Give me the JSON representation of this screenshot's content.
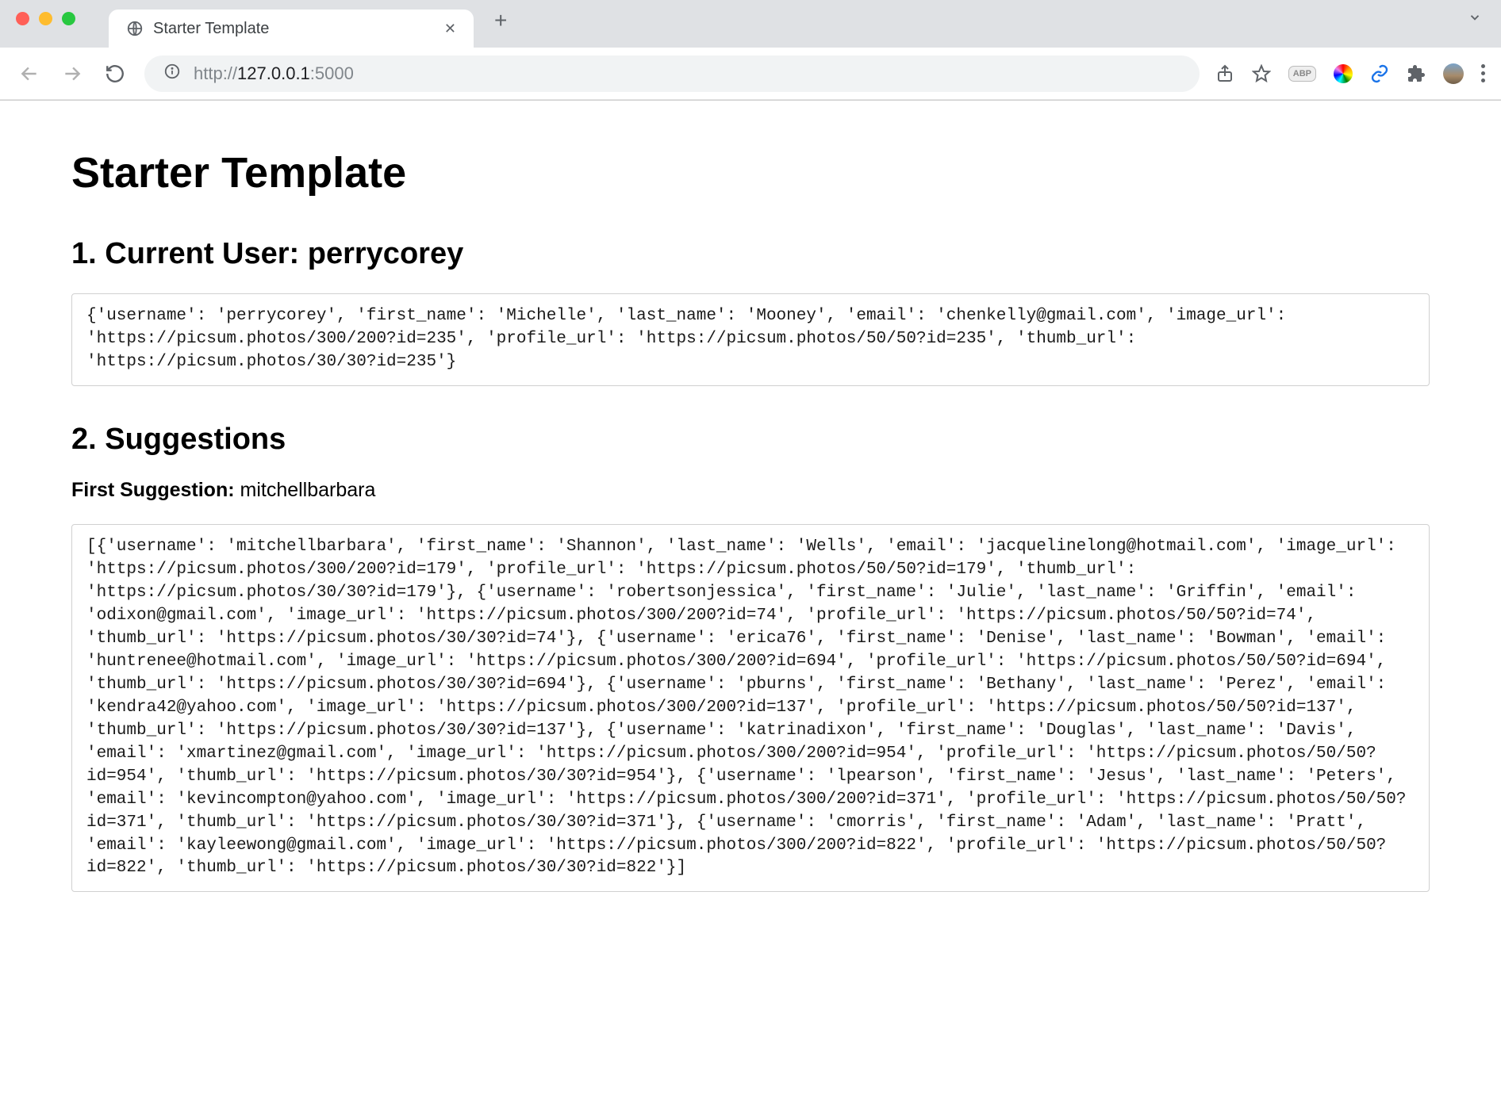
{
  "browser": {
    "tab_title": "Starter Template",
    "url_scheme": "http://",
    "url_host": "127.0.0.1",
    "url_port": ":5000"
  },
  "page": {
    "title": "Starter Template",
    "section1_prefix": "1. Current User: ",
    "current_username": "perrycorey",
    "current_user_dump": "{'username': 'perrycorey', 'first_name': 'Michelle', 'last_name': 'Mooney', 'email': 'chenkelly@gmail.com', 'image_url': 'https://picsum.photos/300/200?id=235', 'profile_url': 'https://picsum.photos/50/50?id=235', 'thumb_url': 'https://picsum.photos/30/30?id=235'}",
    "section2_heading": "2. Suggestions",
    "first_suggestion_label": "First Suggestion: ",
    "first_suggestion_username": "mitchellbarbara",
    "suggestions_dump": "[{'username': 'mitchellbarbara', 'first_name': 'Shannon', 'last_name': 'Wells', 'email': 'jacquelinelong@hotmail.com', 'image_url': 'https://picsum.photos/300/200?id=179', 'profile_url': 'https://picsum.photos/50/50?id=179', 'thumb_url': 'https://picsum.photos/30/30?id=179'}, {'username': 'robertsonjessica', 'first_name': 'Julie', 'last_name': 'Griffin', 'email': 'odixon@gmail.com', 'image_url': 'https://picsum.photos/300/200?id=74', 'profile_url': 'https://picsum.photos/50/50?id=74', 'thumb_url': 'https://picsum.photos/30/30?id=74'}, {'username': 'erica76', 'first_name': 'Denise', 'last_name': 'Bowman', 'email': 'huntrenee@hotmail.com', 'image_url': 'https://picsum.photos/300/200?id=694', 'profile_url': 'https://picsum.photos/50/50?id=694', 'thumb_url': 'https://picsum.photos/30/30?id=694'}, {'username': 'pburns', 'first_name': 'Bethany', 'last_name': 'Perez', 'email': 'kendra42@yahoo.com', 'image_url': 'https://picsum.photos/300/200?id=137', 'profile_url': 'https://picsum.photos/50/50?id=137', 'thumb_url': 'https://picsum.photos/30/30?id=137'}, {'username': 'katrinadixon', 'first_name': 'Douglas', 'last_name': 'Davis', 'email': 'xmartinez@gmail.com', 'image_url': 'https://picsum.photos/300/200?id=954', 'profile_url': 'https://picsum.photos/50/50?id=954', 'thumb_url': 'https://picsum.photos/30/30?id=954'}, {'username': 'lpearson', 'first_name': 'Jesus', 'last_name': 'Peters', 'email': 'kevincompton@yahoo.com', 'image_url': 'https://picsum.photos/300/200?id=371', 'profile_url': 'https://picsum.photos/50/50?id=371', 'thumb_url': 'https://picsum.photos/30/30?id=371'}, {'username': 'cmorris', 'first_name': 'Adam', 'last_name': 'Pratt', 'email': 'kayleewong@gmail.com', 'image_url': 'https://picsum.photos/300/200?id=822', 'profile_url': 'https://picsum.photos/50/50?id=822', 'thumb_url': 'https://picsum.photos/30/30?id=822'}]"
  }
}
